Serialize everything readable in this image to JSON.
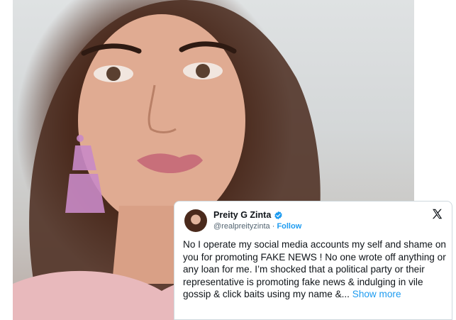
{
  "tweet": {
    "display_name": "Preity G Zinta",
    "handle": "@realpreityzinta",
    "separator": " · ",
    "follow_label": "Follow",
    "body": "No I operate my social media accounts my self and shame on you for promoting FAKE NEWS ! No one wrote off anything or any loan for me. I’m shocked that a political party or their representative is promoting fake news & indulging in vile gossip & click baits using my name &...",
    "show_more_label": "Show more",
    "icons": {
      "verified": "verified-badge-icon",
      "platform": "x-logo-icon"
    },
    "colors": {
      "link": "#1d9bf0",
      "text": "#0f1419",
      "muted": "#536471"
    }
  }
}
